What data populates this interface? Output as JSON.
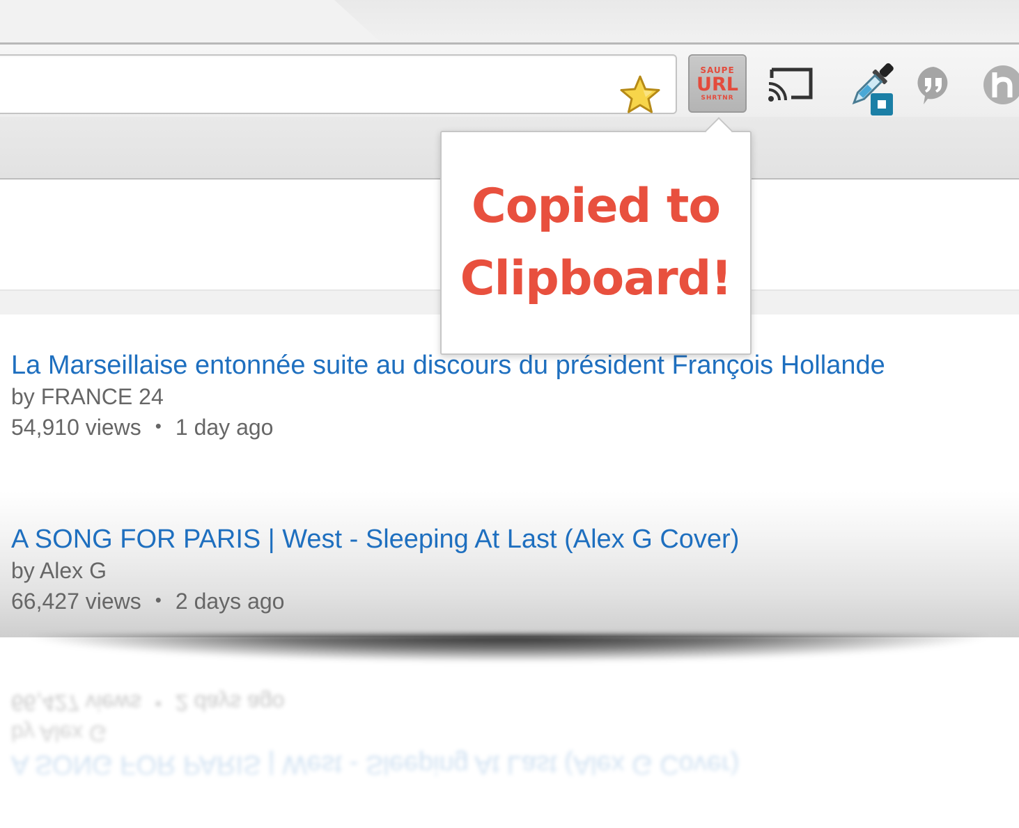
{
  "browser": {
    "omnibox": {
      "value": "",
      "placeholder": ""
    }
  },
  "extensions": {
    "url_shortener": {
      "line1": "SAUPE",
      "line2": "URL",
      "line3": "SHRTNR"
    },
    "icons": [
      "star-icon",
      "cast-icon",
      "eyedropper-icon",
      "quote-icon",
      "h-icon"
    ]
  },
  "popup": {
    "message_line1": "Copied to",
    "message_line2": "Clipboard!",
    "color": "#e8503e"
  },
  "videos": [
    {
      "title": "La Marseillaise entonnée suite au discours du président François Hollande",
      "channel": "by FRANCE 24",
      "views": "54,910 views",
      "age": "1 day ago"
    },
    {
      "title": "A SONG FOR PARIS | West - Sleeping At Last (Alex G Cover)",
      "channel": "by Alex G",
      "views": "66,427 views",
      "age": "2 days ago"
    }
  ],
  "separator": "•",
  "colors": {
    "link": "#1e6fbf",
    "meta": "#666666",
    "accent": "#e34b3c"
  }
}
